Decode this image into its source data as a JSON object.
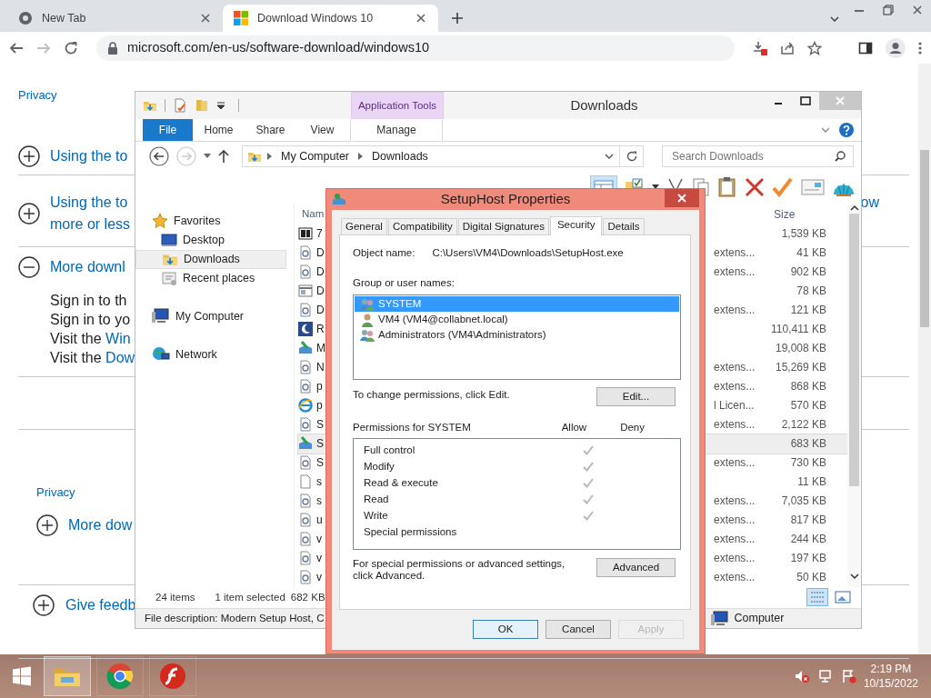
{
  "browser": {
    "tabs": [
      {
        "title": "New Tab",
        "selected": false
      },
      {
        "title": "Download Windows 10",
        "selected": true
      }
    ],
    "url": "microsoft.com/en-us/software-download/windows10"
  },
  "page": {
    "top_link": "Privacy",
    "sections": [
      {
        "expanded": false,
        "lines": [
          "Using the to"
        ]
      },
      {
        "expanded": false,
        "lines": [
          "Using the to",
          "more or less"
        ],
        "right_fragment": "ow"
      },
      {
        "expanded": true,
        "lines": [
          "More downl"
        ],
        "body": [
          {
            "text": "Sign in to th"
          },
          {
            "text": "Sign in to yo"
          },
          {
            "text": "Visit the ",
            "link": "Win"
          },
          {
            "text": "Visit the ",
            "link": "Dow"
          }
        ]
      }
    ],
    "lower_link": "Privacy",
    "lower_sections": [
      {
        "expanded": false,
        "title": "More dow"
      },
      {
        "expanded": false,
        "title": "Give feedb"
      }
    ]
  },
  "explorer": {
    "title": "Downloads",
    "context_group": "Application Tools",
    "ribbon_tabs": [
      {
        "label": "File",
        "kind": "file"
      },
      {
        "label": "Home",
        "kind": "tab"
      },
      {
        "label": "Share",
        "kind": "tab"
      },
      {
        "label": "View",
        "kind": "tab"
      },
      {
        "label": "Manage",
        "kind": "context"
      }
    ],
    "address": [
      "My Computer",
      "Downloads"
    ],
    "search_placeholder": "Search Downloads",
    "nav": [
      {
        "label": "Favorites",
        "kind": "favorites",
        "selected": false,
        "children": [
          {
            "label": "Desktop",
            "kind": "desktop",
            "selected": false
          },
          {
            "label": "Downloads",
            "kind": "downloads",
            "selected": true
          },
          {
            "label": "Recent places",
            "kind": "recent",
            "selected": false
          }
        ]
      },
      {
        "label": "My Computer",
        "kind": "computer",
        "selected": false
      },
      {
        "label": "Network",
        "kind": "network",
        "selected": false
      }
    ],
    "columns": [
      "Nam",
      "Size"
    ],
    "files": [
      {
        "name": "7",
        "kind": "archive",
        "size": "1,539 KB",
        "selected": false
      },
      {
        "name": "D",
        "kind": "config",
        "type": "extens...",
        "size": "41 KB",
        "selected": false
      },
      {
        "name": "D",
        "kind": "config",
        "type": "extens...",
        "size": "902 KB",
        "selected": false
      },
      {
        "name": "D",
        "kind": "window",
        "size": "78 KB",
        "selected": false
      },
      {
        "name": "D",
        "kind": "config",
        "type": "extens...",
        "size": "121 KB",
        "selected": false
      },
      {
        "name": "R",
        "kind": "moon",
        "size": "110,411 KB",
        "selected": false
      },
      {
        "name": "M",
        "kind": "setup",
        "size": "19,008 KB",
        "selected": false
      },
      {
        "name": "N",
        "kind": "config",
        "type": "extens...",
        "size": "15,269 KB",
        "selected": false
      },
      {
        "name": "p",
        "kind": "config",
        "type": "extens...",
        "size": "868 KB",
        "selected": false
      },
      {
        "name": "p",
        "kind": "browser",
        "type": "l Licen...",
        "size": "570 KB",
        "selected": false
      },
      {
        "name": "S",
        "kind": "config",
        "type": "extens...",
        "size": "2,122 KB",
        "selected": false
      },
      {
        "name": "S",
        "kind": "setup",
        "size": "683 KB",
        "selected": true
      },
      {
        "name": "S",
        "kind": "config",
        "type": "extens...",
        "size": "730 KB",
        "selected": false
      },
      {
        "name": "s",
        "kind": "blank",
        "size": "11 KB",
        "selected": false
      },
      {
        "name": "s",
        "kind": "config",
        "type": "extens...",
        "size": "7,035 KB",
        "selected": false
      },
      {
        "name": "u",
        "kind": "config",
        "type": "extens...",
        "size": "817 KB",
        "selected": false
      },
      {
        "name": "v",
        "kind": "config",
        "type": "extens...",
        "size": "244 KB",
        "selected": false
      },
      {
        "name": "v",
        "kind": "config",
        "type": "extens...",
        "size": "197 KB",
        "selected": false
      },
      {
        "name": "v",
        "kind": "config",
        "type": "extens...",
        "size": "50 KB",
        "selected": false
      }
    ],
    "status": {
      "count": "24 items",
      "selection": "1 item selected",
      "selection_size": "682 KB"
    },
    "details": {
      "description": "File description: Modern Setup Host, C",
      "location": "Computer"
    }
  },
  "dialog": {
    "title": "SetupHost Properties",
    "tabs": [
      {
        "label": "General",
        "selected": false
      },
      {
        "label": "Compatibility",
        "selected": false
      },
      {
        "label": "Digital Signatures",
        "selected": false
      },
      {
        "label": "Security",
        "selected": true
      },
      {
        "label": "Details",
        "selected": false
      }
    ],
    "object_label": "Object name:",
    "object_value": "C:\\Users\\VM4\\Downloads\\SetupHost.exe",
    "group_label": "Group or user names:",
    "users": [
      {
        "name": "SYSTEM",
        "kind": "group",
        "selected": true
      },
      {
        "name": "VM4 (VM4@collabnet.local)",
        "kind": "user",
        "selected": false
      },
      {
        "name": "Administrators (VM4\\Administrators)",
        "kind": "group",
        "selected": false
      }
    ],
    "edit_hint": "To change permissions, click Edit.",
    "edit_button": "Edit...",
    "permissions_label": "Permissions for SYSTEM",
    "allow_label": "Allow",
    "deny_label": "Deny",
    "permissions": [
      {
        "name": "Full control",
        "allow": true,
        "deny": false
      },
      {
        "name": "Modify",
        "allow": true,
        "deny": false
      },
      {
        "name": "Read & execute",
        "allow": true,
        "deny": false
      },
      {
        "name": "Read",
        "allow": true,
        "deny": false
      },
      {
        "name": "Write",
        "allow": true,
        "deny": false
      },
      {
        "name": "Special permissions",
        "allow": false,
        "deny": false
      }
    ],
    "advanced_hint": "For special permissions or advanced settings, click Advanced.",
    "advanced_button": "Advanced",
    "buttons": [
      {
        "label": "OK",
        "default": true,
        "disabled": false
      },
      {
        "label": "Cancel",
        "default": false,
        "disabled": false
      },
      {
        "label": "Apply",
        "default": false,
        "disabled": true
      }
    ]
  },
  "taskbar": {
    "time": "2:19 PM",
    "date": "10/15/2022"
  }
}
